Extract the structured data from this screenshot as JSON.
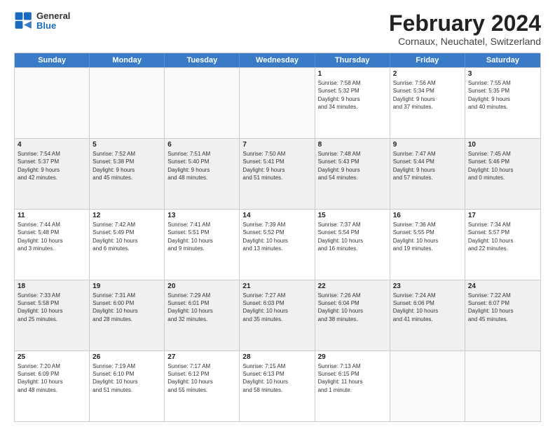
{
  "logo": {
    "general": "General",
    "blue": "Blue"
  },
  "title": {
    "month_year": "February 2024",
    "location": "Cornaux, Neuchatel, Switzerland"
  },
  "days_header": [
    "Sunday",
    "Monday",
    "Tuesday",
    "Wednesday",
    "Thursday",
    "Friday",
    "Saturday"
  ],
  "weeks": [
    {
      "shaded": false,
      "cells": [
        {
          "date": "",
          "info": ""
        },
        {
          "date": "",
          "info": ""
        },
        {
          "date": "",
          "info": ""
        },
        {
          "date": "",
          "info": ""
        },
        {
          "date": "1",
          "info": "Sunrise: 7:58 AM\nSunset: 5:32 PM\nDaylight: 9 hours\nand 34 minutes."
        },
        {
          "date": "2",
          "info": "Sunrise: 7:56 AM\nSunset: 5:34 PM\nDaylight: 9 hours\nand 37 minutes."
        },
        {
          "date": "3",
          "info": "Sunrise: 7:55 AM\nSunset: 5:35 PM\nDaylight: 9 hours\nand 40 minutes."
        }
      ]
    },
    {
      "shaded": true,
      "cells": [
        {
          "date": "4",
          "info": "Sunrise: 7:54 AM\nSunset: 5:37 PM\nDaylight: 9 hours\nand 42 minutes."
        },
        {
          "date": "5",
          "info": "Sunrise: 7:52 AM\nSunset: 5:38 PM\nDaylight: 9 hours\nand 45 minutes."
        },
        {
          "date": "6",
          "info": "Sunrise: 7:51 AM\nSunset: 5:40 PM\nDaylight: 9 hours\nand 48 minutes."
        },
        {
          "date": "7",
          "info": "Sunrise: 7:50 AM\nSunset: 5:41 PM\nDaylight: 9 hours\nand 51 minutes."
        },
        {
          "date": "8",
          "info": "Sunrise: 7:48 AM\nSunset: 5:43 PM\nDaylight: 9 hours\nand 54 minutes."
        },
        {
          "date": "9",
          "info": "Sunrise: 7:47 AM\nSunset: 5:44 PM\nDaylight: 9 hours\nand 57 minutes."
        },
        {
          "date": "10",
          "info": "Sunrise: 7:45 AM\nSunset: 5:46 PM\nDaylight: 10 hours\nand 0 minutes."
        }
      ]
    },
    {
      "shaded": false,
      "cells": [
        {
          "date": "11",
          "info": "Sunrise: 7:44 AM\nSunset: 5:48 PM\nDaylight: 10 hours\nand 3 minutes."
        },
        {
          "date": "12",
          "info": "Sunrise: 7:42 AM\nSunset: 5:49 PM\nDaylight: 10 hours\nand 6 minutes."
        },
        {
          "date": "13",
          "info": "Sunrise: 7:41 AM\nSunset: 5:51 PM\nDaylight: 10 hours\nand 9 minutes."
        },
        {
          "date": "14",
          "info": "Sunrise: 7:39 AM\nSunset: 5:52 PM\nDaylight: 10 hours\nand 13 minutes."
        },
        {
          "date": "15",
          "info": "Sunrise: 7:37 AM\nSunset: 5:54 PM\nDaylight: 10 hours\nand 16 minutes."
        },
        {
          "date": "16",
          "info": "Sunrise: 7:36 AM\nSunset: 5:55 PM\nDaylight: 10 hours\nand 19 minutes."
        },
        {
          "date": "17",
          "info": "Sunrise: 7:34 AM\nSunset: 5:57 PM\nDaylight: 10 hours\nand 22 minutes."
        }
      ]
    },
    {
      "shaded": true,
      "cells": [
        {
          "date": "18",
          "info": "Sunrise: 7:33 AM\nSunset: 5:58 PM\nDaylight: 10 hours\nand 25 minutes."
        },
        {
          "date": "19",
          "info": "Sunrise: 7:31 AM\nSunset: 6:00 PM\nDaylight: 10 hours\nand 28 minutes."
        },
        {
          "date": "20",
          "info": "Sunrise: 7:29 AM\nSunset: 6:01 PM\nDaylight: 10 hours\nand 32 minutes."
        },
        {
          "date": "21",
          "info": "Sunrise: 7:27 AM\nSunset: 6:03 PM\nDaylight: 10 hours\nand 35 minutes."
        },
        {
          "date": "22",
          "info": "Sunrise: 7:26 AM\nSunset: 6:04 PM\nDaylight: 10 hours\nand 38 minutes."
        },
        {
          "date": "23",
          "info": "Sunrise: 7:24 AM\nSunset: 6:06 PM\nDaylight: 10 hours\nand 41 minutes."
        },
        {
          "date": "24",
          "info": "Sunrise: 7:22 AM\nSunset: 6:07 PM\nDaylight: 10 hours\nand 45 minutes."
        }
      ]
    },
    {
      "shaded": false,
      "cells": [
        {
          "date": "25",
          "info": "Sunrise: 7:20 AM\nSunset: 6:09 PM\nDaylight: 10 hours\nand 48 minutes."
        },
        {
          "date": "26",
          "info": "Sunrise: 7:19 AM\nSunset: 6:10 PM\nDaylight: 10 hours\nand 51 minutes."
        },
        {
          "date": "27",
          "info": "Sunrise: 7:17 AM\nSunset: 6:12 PM\nDaylight: 10 hours\nand 55 minutes."
        },
        {
          "date": "28",
          "info": "Sunrise: 7:15 AM\nSunset: 6:13 PM\nDaylight: 10 hours\nand 58 minutes."
        },
        {
          "date": "29",
          "info": "Sunrise: 7:13 AM\nSunset: 6:15 PM\nDaylight: 11 hours\nand 1 minute."
        },
        {
          "date": "",
          "info": ""
        },
        {
          "date": "",
          "info": ""
        }
      ]
    }
  ]
}
